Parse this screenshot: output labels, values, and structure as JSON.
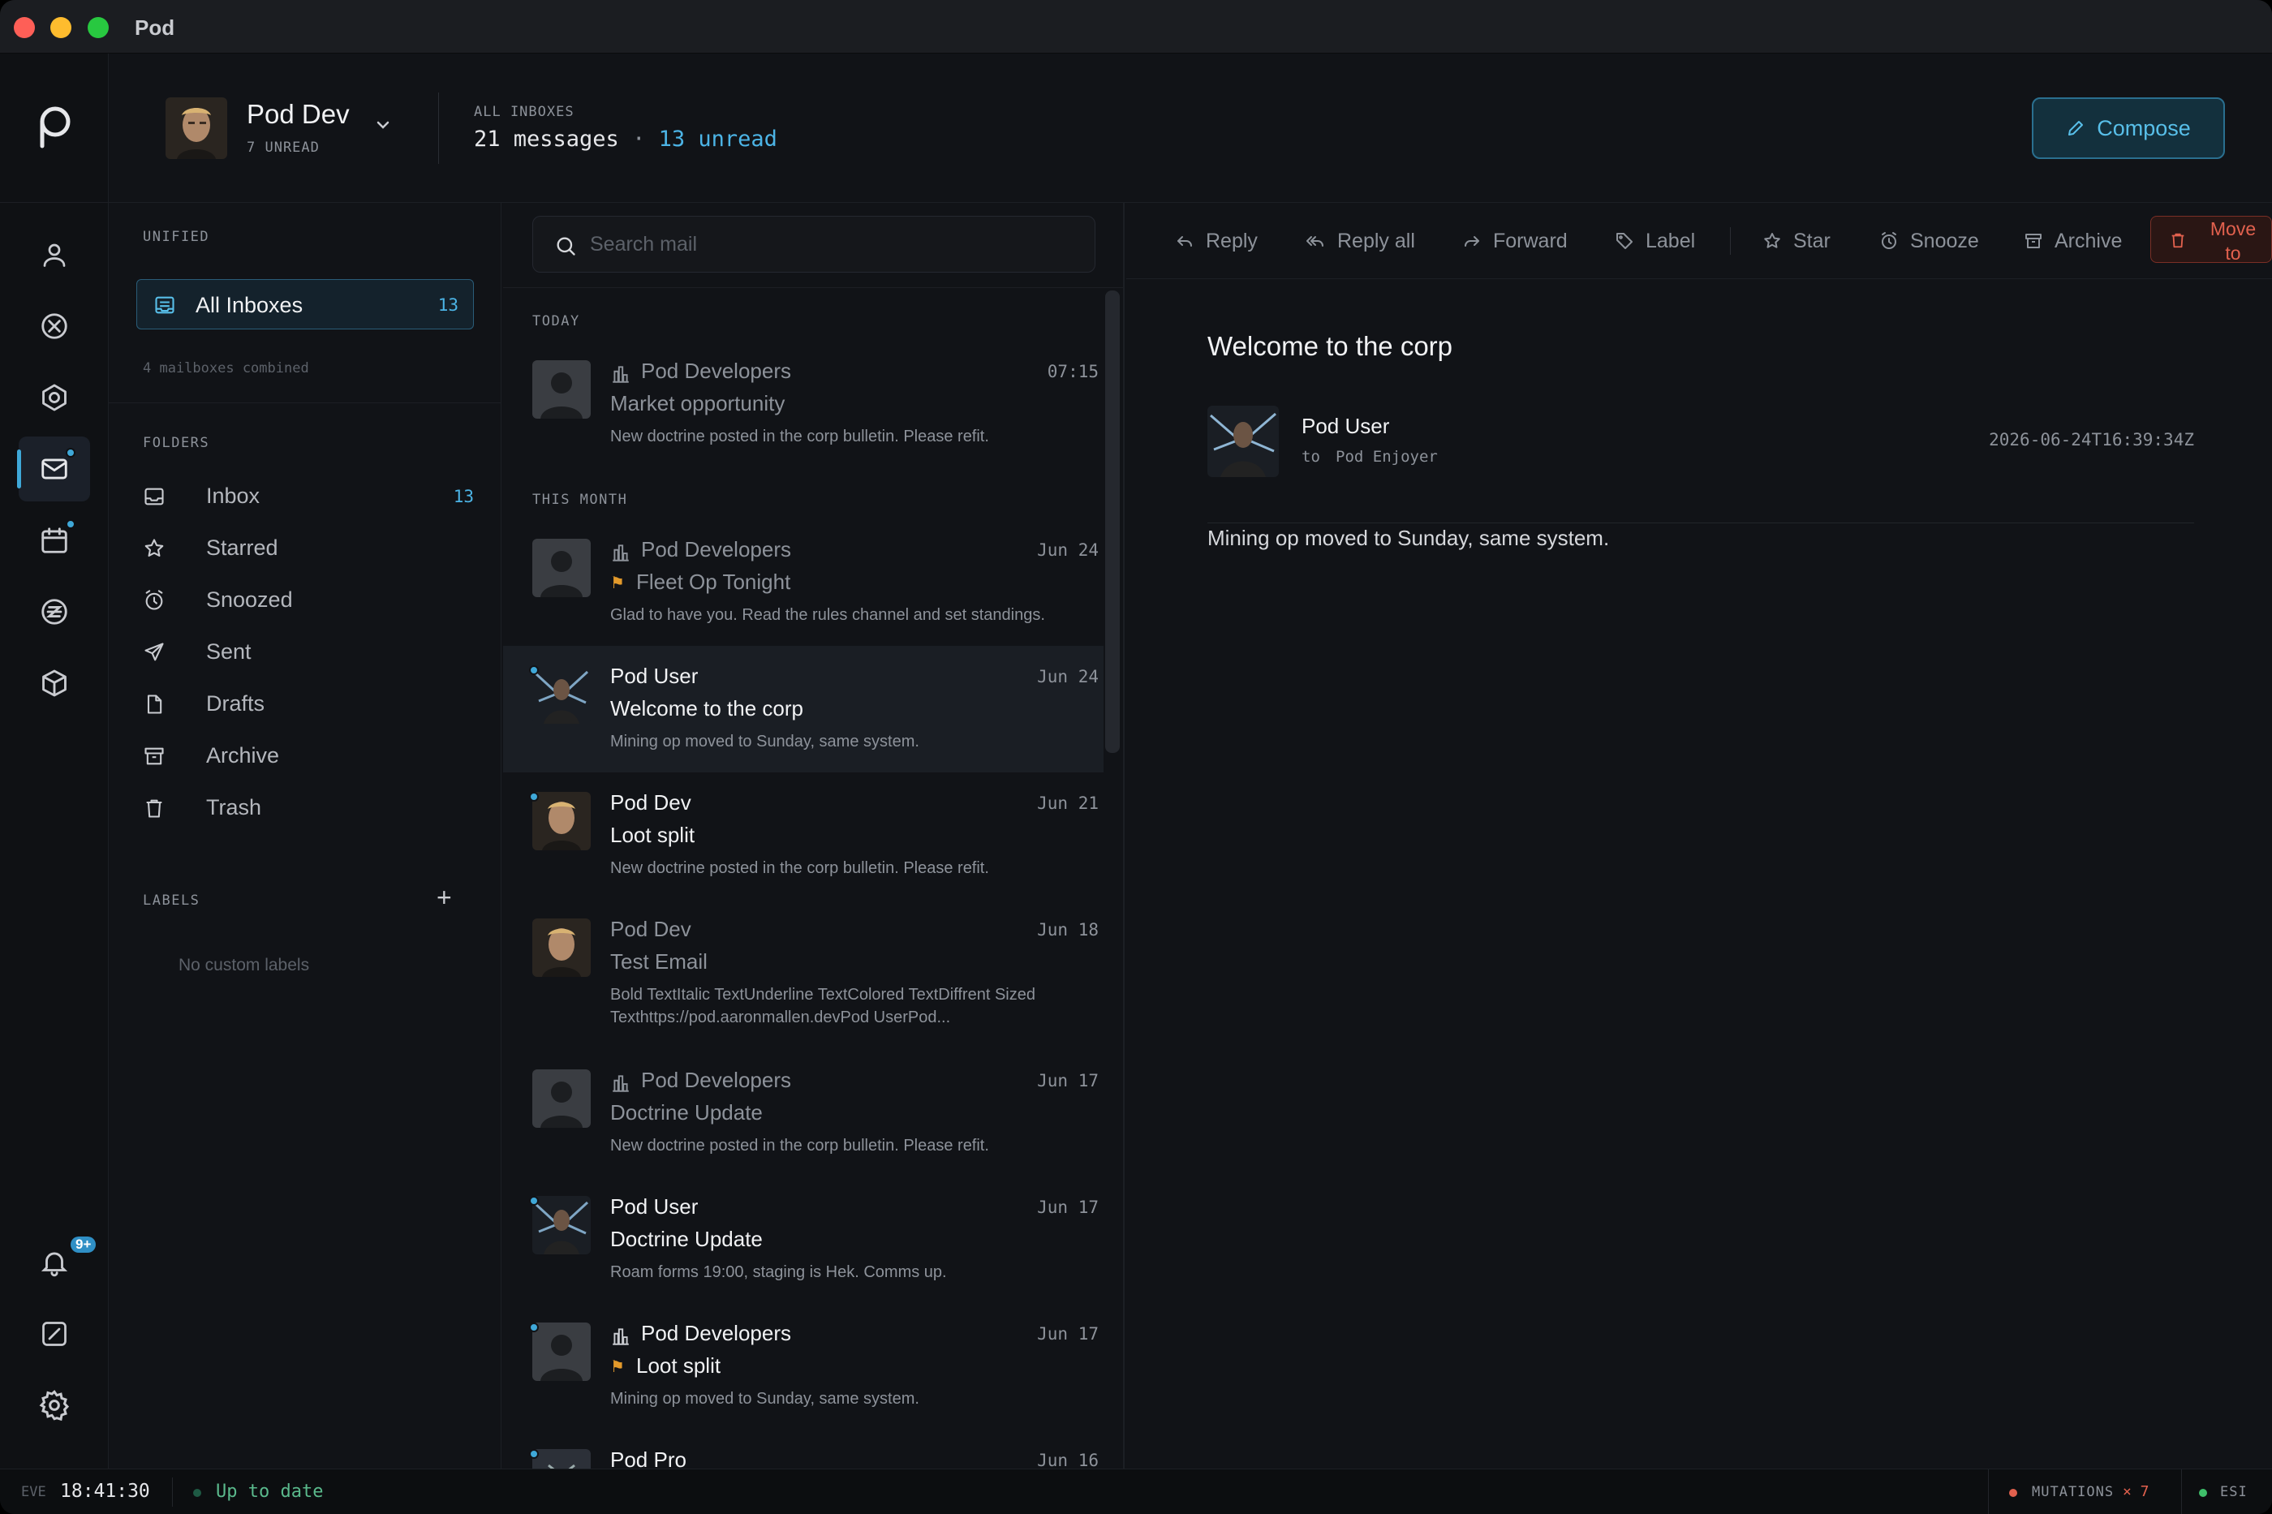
{
  "window": {
    "title": "Pod"
  },
  "header": {
    "user_name": "Pod Dev",
    "user_unread": "7 UNREAD",
    "all_inboxes_label": "ALL INBOXES",
    "message_count": "21 messages",
    "separator": "·",
    "unread_count": "13 unread",
    "compose_label": "Compose"
  },
  "rail": {
    "icons": [
      "logo-icon",
      "person-icon",
      "crossed-circle-icon",
      "hexagon-icon",
      "mail-icon",
      "calendar-icon",
      "z-coin-icon",
      "cube-icon",
      "bell-icon",
      "chart-icon",
      "gear-icon"
    ],
    "notification_badge": "9+"
  },
  "sidebar": {
    "unified_label": "UNIFIED",
    "all_inboxes": {
      "label": "All Inboxes",
      "count": "13"
    },
    "mailboxes_combined": "4 mailboxes combined",
    "folders_label": "FOLDERS",
    "folders": [
      {
        "label": "Inbox",
        "count": "13",
        "icon": "inbox-icon"
      },
      {
        "label": "Starred",
        "count": "",
        "icon": "star-icon"
      },
      {
        "label": "Snoozed",
        "count": "",
        "icon": "clock-icon"
      },
      {
        "label": "Sent",
        "count": "",
        "icon": "send-icon"
      },
      {
        "label": "Drafts",
        "count": "",
        "icon": "file-icon"
      },
      {
        "label": "Archive",
        "count": "",
        "icon": "archive-icon"
      },
      {
        "label": "Trash",
        "count": "",
        "icon": "trash-icon"
      }
    ],
    "labels_label": "LABELS",
    "add_label": "+",
    "no_labels": "No custom labels"
  },
  "list": {
    "search_placeholder": "Search mail",
    "group_today": "TODAY",
    "group_month": "THIS MONTH",
    "messages": [
      {
        "sender": "Pod Developers",
        "corp": true,
        "date": "07:15",
        "subject": "Market opportunity",
        "preview": "New doctrine posted in the corp bulletin. Please refit.",
        "unread": false,
        "flag": false
      },
      {
        "sender": "Pod Developers",
        "corp": true,
        "date": "Jun 24",
        "subject": "Fleet Op Tonight",
        "preview": "Glad to have you. Read the rules channel and set standings.",
        "unread": false,
        "flag": true
      },
      {
        "sender": "Pod User",
        "corp": false,
        "date": "Jun 24",
        "subject": "Welcome to the corp",
        "preview": "Mining op moved to Sunday, same system.",
        "unread": true,
        "flag": false
      },
      {
        "sender": "Pod Dev",
        "corp": false,
        "date": "Jun 21",
        "subject": "Loot split",
        "preview": "New doctrine posted in the corp bulletin. Please refit.",
        "unread": true,
        "flag": false
      },
      {
        "sender": "Pod Dev",
        "corp": false,
        "date": "Jun 18",
        "subject": "Test Email",
        "preview": "Bold TextItalic TextUnderline TextColored TextDiffrent Sized Texthttps://pod.aaronmallen.devPod UserPod...",
        "unread": false,
        "flag": false
      },
      {
        "sender": "Pod Developers",
        "corp": true,
        "date": "Jun 17",
        "subject": "Doctrine Update",
        "preview": "New doctrine posted in the corp bulletin. Please refit.",
        "unread": false,
        "flag": false
      },
      {
        "sender": "Pod User",
        "corp": false,
        "date": "Jun 17",
        "subject": "Doctrine Update",
        "preview": "Roam forms 19:00, staging is Hek. Comms up.",
        "unread": true,
        "flag": false
      },
      {
        "sender": "Pod Developers",
        "corp": true,
        "date": "Jun 17",
        "subject": "Loot split",
        "preview": "Mining op moved to Sunday, same system.",
        "unread": true,
        "flag": true
      },
      {
        "sender": "Pod Pro",
        "corp": false,
        "date": "Jun 16",
        "subject": "",
        "preview": "",
        "unread": true,
        "flag": false
      }
    ]
  },
  "toolbar": {
    "reply": "Reply",
    "reply_all": "Reply all",
    "forward": "Forward",
    "label": "Label",
    "star": "Star",
    "snooze": "Snooze",
    "archive": "Archive",
    "move_to_1": "Move",
    "move_to_2": "to"
  },
  "message": {
    "subject": "Welcome to the corp",
    "from": "Pod User",
    "to_label": "to",
    "to": "Pod Enjoyer",
    "time": "2026-06-24T16:39:34Z",
    "body": "Mining op moved to Sunday, same system."
  },
  "status": {
    "eve_label": "EVE",
    "eve_time": "18:41:30",
    "sync": "Up to date",
    "mutations_label": "MUTATIONS",
    "mutations_count": "× 7",
    "esi_label": "ESI"
  },
  "colors": {
    "accent": "#3fa8d8",
    "danger": "#e2614e",
    "success": "#5ab98c",
    "flag": "#e39a2b"
  }
}
